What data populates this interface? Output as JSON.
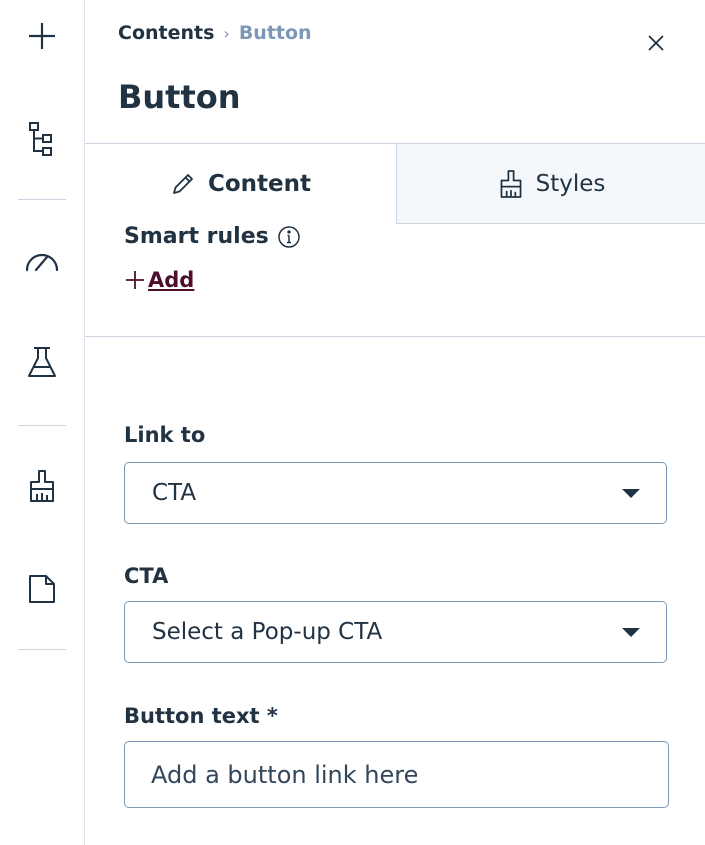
{
  "rail": {
    "icons": [
      "plus-icon",
      "tree-structure-icon",
      "speedometer-icon",
      "flask-icon",
      "brush-icon",
      "page-icon"
    ]
  },
  "breadcrumb": {
    "parent": "Contents",
    "separator": "›",
    "current": "Button"
  },
  "panel": {
    "title": "Button"
  },
  "tabs": [
    {
      "label": "Content",
      "icon": "pencil-icon",
      "active": true
    },
    {
      "label": "Styles",
      "icon": "brush-icon",
      "active": false
    }
  ],
  "smart_rules": {
    "label": "Smart rules",
    "add_label": "Add"
  },
  "fields": {
    "link_to": {
      "label": "Link to",
      "value": "CTA"
    },
    "cta": {
      "label": "CTA",
      "value": "Select a Pop-up CTA"
    },
    "button_text": {
      "label": "Button text *",
      "placeholder": "Add a button link here",
      "value": ""
    }
  },
  "colors": {
    "text": "#213343",
    "muted": "#7c98b6",
    "link": "#4e0f2c",
    "border": "#cbd6e2",
    "inactive_tab": "#f5f8fa"
  }
}
